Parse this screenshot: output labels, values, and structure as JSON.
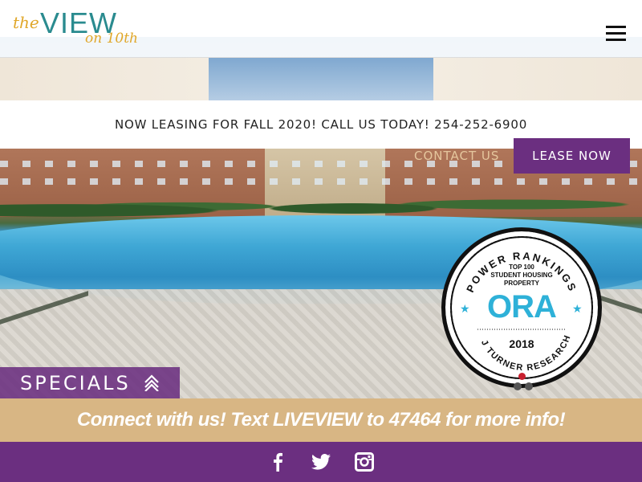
{
  "logo": {
    "the": "the",
    "view": "VIEW",
    "on10": "on 10th"
  },
  "announcement": "NOW LEASING FOR FALL 2020! CALL US TODAY! 254-252-6900",
  "nav": {
    "contact_label": "CONTACT US",
    "lease_label": "LEASE NOW"
  },
  "badge": {
    "arc_top": "POWER RANKINGS",
    "line1": "TOP 100",
    "line2": "STUDENT HOUSING",
    "line3": "PROPERTY",
    "brand": "ORA",
    "year": "2018",
    "arc_bottom": "J TURNER RESEARCH"
  },
  "specials": {
    "label": "SPECIALS"
  },
  "connect": {
    "text": "Connect with us! Text LIVEVIEW to 47464 for more info!"
  },
  "social": [
    "facebook-icon",
    "twitter-icon",
    "instagram-icon"
  ],
  "colors": {
    "purple": "#6b2f80",
    "tan": "#d8b684",
    "teal": "#2a8b8f",
    "gold": "#e0a72a",
    "ora_blue": "#2eb1d8"
  }
}
